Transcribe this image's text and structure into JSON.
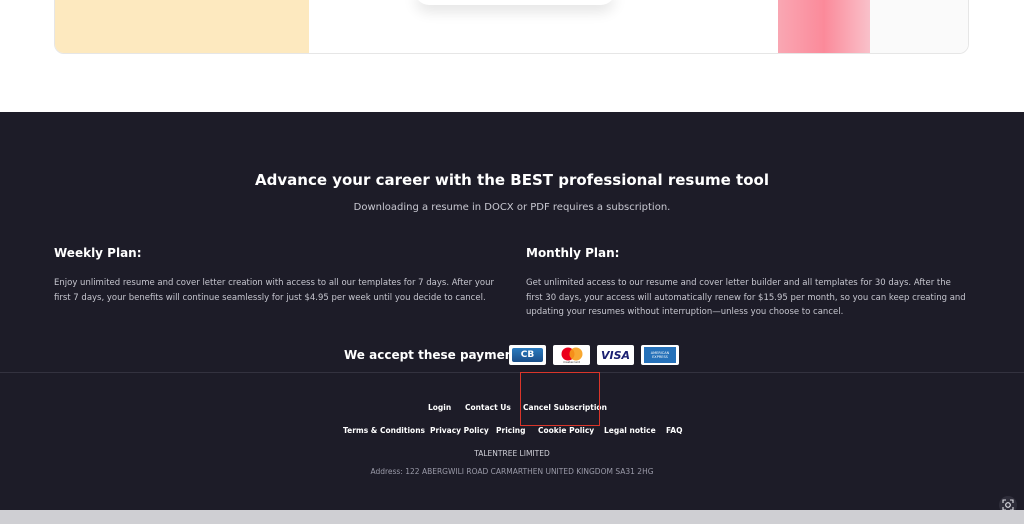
{
  "hero": {
    "headline": "Advance your career with the BEST professional resume tool",
    "subtitle": "Downloading a resume in DOCX or PDF requires a subscription."
  },
  "plans": {
    "weekly": {
      "title": "Weekly Plan:",
      "description": "Enjoy unlimited resume and cover letter creation with access to all our templates for 7 days. After your first 7 days, your benefits will continue seamlessly for just $4.95 per week until you decide to cancel."
    },
    "monthly": {
      "title": "Monthly Plan:",
      "description": "Get unlimited access to our resume and cover letter builder and all templates for 30 days. After the first 30 days, your access will automatically renew for $15.95 per month, so you can keep creating and updating your resumes without interruption—unless you choose to cancel."
    }
  },
  "payments": {
    "label": "We accept these payments:",
    "methods": [
      "CB",
      "mastercard",
      "VISA",
      "AMERICAN EXPRESS"
    ]
  },
  "nav": {
    "row1": [
      "Login",
      "Contact Us",
      "Cancel Subscription"
    ],
    "row2": [
      "Terms & Conditions",
      "Privacy Policy",
      "Pricing",
      "Cookie Policy",
      "Legal notice",
      "FAQ"
    ]
  },
  "company": {
    "name": "TALENTREE LIMITED",
    "address": "Address: 122 ABERGWILI ROAD CARMARTHEN UNITED KINGDOM SA31 2HG"
  },
  "colors": {
    "footer_bg": "#1d1c28",
    "highlight": "#d9352a"
  }
}
